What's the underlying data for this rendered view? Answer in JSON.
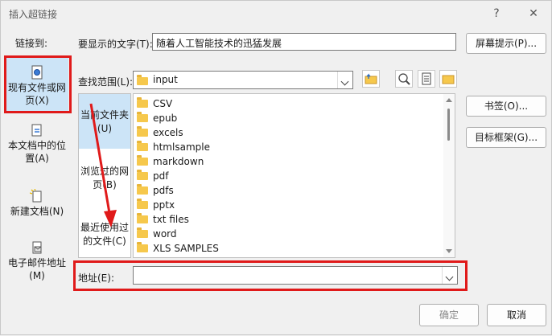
{
  "window": {
    "title": "插入超链接",
    "help": "?",
    "close": "✕"
  },
  "nav": {
    "label": "链接到:",
    "items": [
      {
        "label": "现有文件或网页(X)",
        "icon": "existing-file-icon"
      },
      {
        "label": "本文档中的位置(A)",
        "icon": "document-location-icon"
      },
      {
        "label": "新建文档(N)",
        "icon": "new-document-icon"
      },
      {
        "label": "电子邮件地址(M)",
        "icon": "email-icon"
      }
    ]
  },
  "display_text": {
    "label": "要显示的文字(T):",
    "value": "随着人工智能技术的迅猛发展"
  },
  "screentip_button": "屏幕提示(P)...",
  "lookin": {
    "label": "查找范围(L):",
    "value": "input"
  },
  "subnav": {
    "items": [
      {
        "label": "当前文件夹(U)"
      },
      {
        "label": "浏览过的网页(B)"
      },
      {
        "label": "最近使用过的文件(C)"
      }
    ]
  },
  "files": [
    "CSV",
    "epub",
    "excels",
    "htmlsample",
    "markdown",
    "pdf",
    "pdfs",
    "pptx",
    "txt files",
    "word",
    "XLS SAMPLES"
  ],
  "side_buttons": {
    "bookmark": "书签(O)...",
    "target_frame": "目标框架(G)..."
  },
  "address": {
    "label": "地址(E):",
    "value": ""
  },
  "footer": {
    "ok": "确定",
    "cancel": "取消"
  },
  "colors": {
    "annotation_red": "#e01a1a",
    "selection_blue": "#cce4f7"
  }
}
